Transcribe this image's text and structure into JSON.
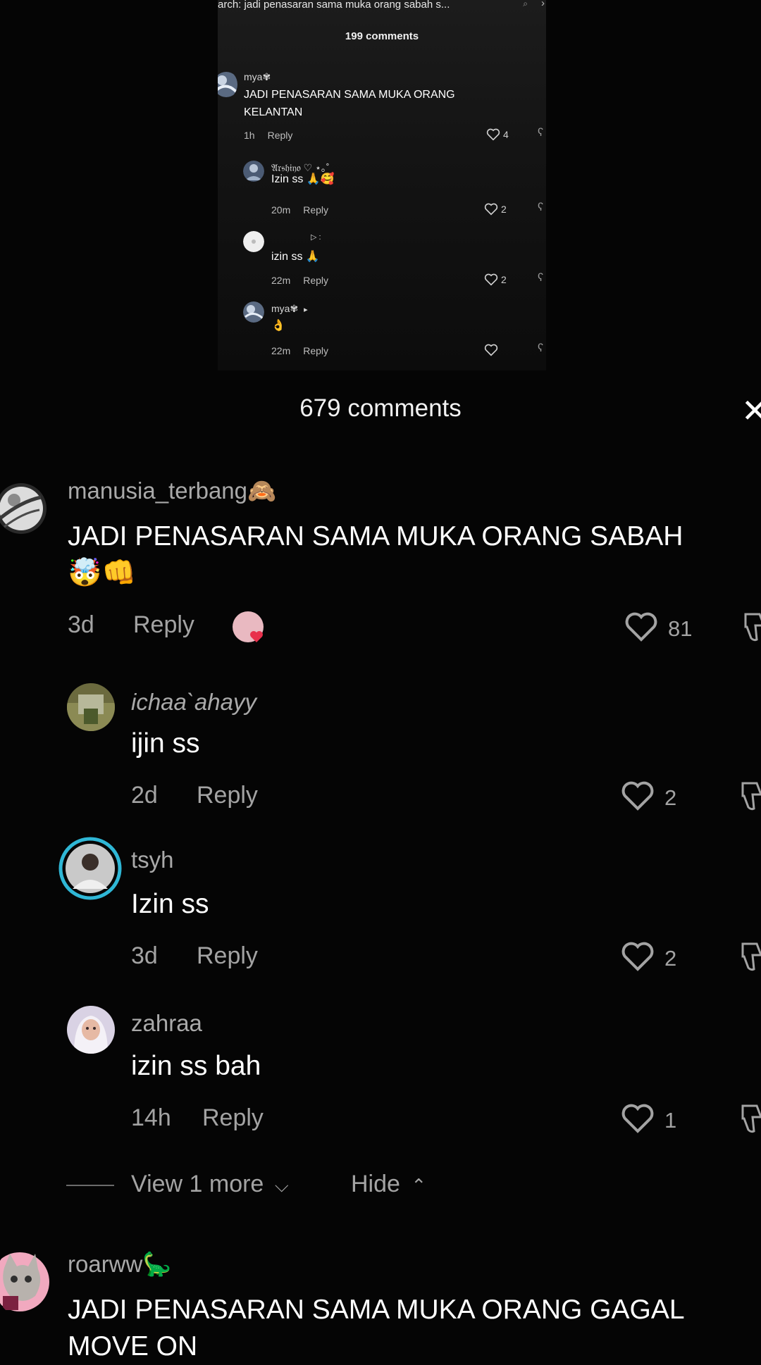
{
  "embedded": {
    "search_text": "arch: jadi penasaran sama muka orang sabah s...",
    "comment_count": "199 comments",
    "comments": [
      {
        "user": "mya",
        "text1": "JADI PENASARAN SAMA MUKA ORANG",
        "text2": "KELANTAN",
        "time": "1h",
        "reply": "Reply",
        "likes": "4"
      },
      {
        "user": "𝔄𝔯𝔰𝔥𝔦𝔶𝔬 ♡ ⋆｡˚",
        "text": "Izin ss 🙏🥰",
        "time": "20m",
        "reply": "Reply",
        "likes": "2"
      },
      {
        "user": "",
        "reply_to": "▷ :",
        "text": "izin ss 🙏",
        "time": "22m",
        "reply": "Reply",
        "likes": "2"
      },
      {
        "user": "mya",
        "reply_to": "▸",
        "text": "👌",
        "time": "22m",
        "reply": "Reply",
        "likes": ""
      }
    ]
  },
  "sheet": {
    "title": "679 comments",
    "close_icon": "close-icon"
  },
  "comments": [
    {
      "username": "manusia_terbang",
      "username_emoji": "🙈",
      "text": "JADI PENASARAN SAMA MUKA ORANG SABAH",
      "text_emoji": "🤯👊",
      "time": "3d",
      "reply": "Reply",
      "likes": "81"
    },
    {
      "username": "ichaa`ahayy",
      "text": "ijin ss",
      "time": "2d",
      "reply": "Reply",
      "likes": "2"
    },
    {
      "username": "tsyh",
      "text": "Izin ss",
      "time": "3d",
      "reply": "Reply",
      "likes": "2"
    },
    {
      "username": "zahraa",
      "text": "izin ss bah",
      "time": "14h",
      "reply": "Reply",
      "likes": "1"
    },
    {
      "username": "roarww",
      "username_emoji": "🦕",
      "text_line1": "JADI PENASARAN SAMA MUKA ORANG GAGAL",
      "text_line2": "MOVE ON"
    }
  ],
  "thread_controls": {
    "view_more": "View 1 more",
    "hide": "Hide"
  },
  "colors": {
    "background": "#050505",
    "secondary_text": "#a3a3a3",
    "story_ring": "#2fb7d6",
    "like_badge": "#e8304c"
  }
}
